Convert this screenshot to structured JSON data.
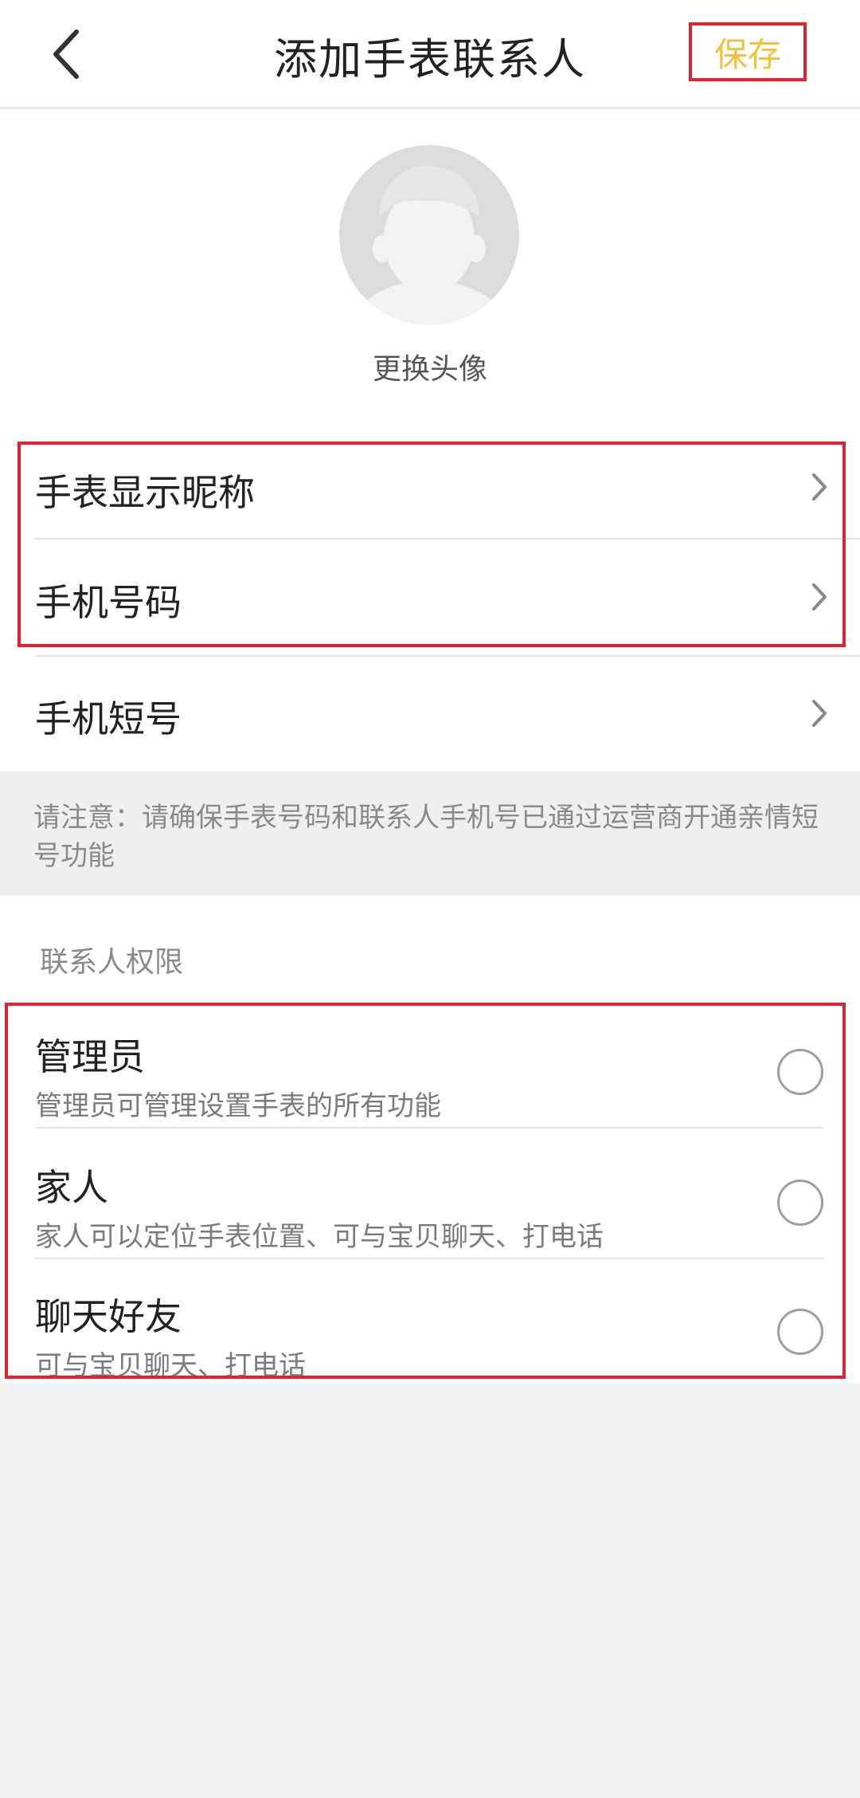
{
  "header": {
    "back_icon": "chevron-left-icon",
    "title": "添加手表联系人",
    "save_label": "保存",
    "save_color": "#f2c23f"
  },
  "avatar": {
    "icon": "default-avatar-icon",
    "change_label": "更换头像"
  },
  "form": {
    "rows": [
      {
        "label": "手表显示昵称",
        "icon": "chevron-right-icon"
      },
      {
        "label": "手机号码",
        "icon": "chevron-right-icon"
      },
      {
        "label": "手机短号",
        "icon": "chevron-right-icon"
      }
    ]
  },
  "notice": {
    "text": "请注意：请确保手表号码和联系人手机号已通过运营商开通亲情短号功能"
  },
  "permissions": {
    "heading": "联系人权限",
    "options": [
      {
        "title": "管理员",
        "description": "管理员可管理设置手表的所有功能",
        "selected": false
      },
      {
        "title": "家人",
        "description": "家人可以定位手表位置、可与宝贝聊天、打电话",
        "selected": false
      },
      {
        "title": "聊天好友",
        "description": "可与宝贝聊天、打电话",
        "selected": false
      }
    ]
  },
  "colors": {
    "highlight_frame": "#e0232e",
    "page_background": "#f0f0f0"
  }
}
